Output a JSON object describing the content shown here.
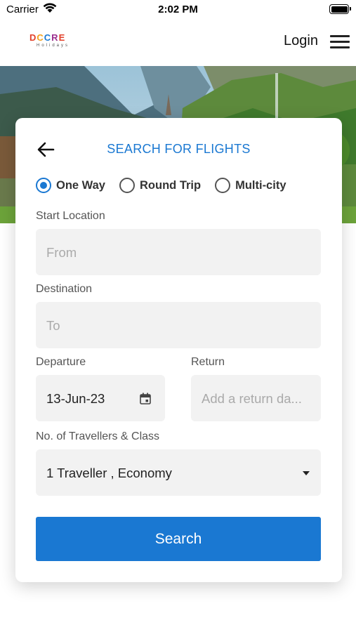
{
  "status_bar": {
    "carrier": "Carrier",
    "time": "2:02 PM",
    "battery_level": 1.0
  },
  "navbar": {
    "logo_letters": [
      "D",
      "C",
      "C",
      "R",
      "E"
    ],
    "logo_colors": [
      "#e2412b",
      "#f4a21c",
      "#1a78d2",
      "#9b2f8f",
      "#e2412b"
    ],
    "logo_subtitle": "Holidays",
    "login_label": "Login",
    "menu_icon": "hamburger-icon"
  },
  "search": {
    "back_icon": "arrow-left-icon",
    "title": "SEARCH FOR FLIGHTS",
    "trip_types": [
      {
        "label": "One Way",
        "selected": true
      },
      {
        "label": "Round Trip",
        "selected": false
      },
      {
        "label": "Multi-city",
        "selected": false
      }
    ],
    "start_location": {
      "label": "Start Location",
      "placeholder": "From",
      "value": ""
    },
    "destination": {
      "label": "Destination",
      "placeholder": "To",
      "value": ""
    },
    "departure": {
      "label": "Departure",
      "value": "13-Jun-23",
      "icon": "calendar-icon"
    },
    "return": {
      "label": "Return",
      "placeholder": "Add a return da..."
    },
    "travellers": {
      "label": "No. of Travellers & Class",
      "value": "1 Traveller , Economy",
      "icon": "caret-down-icon"
    },
    "submit_label": "Search"
  },
  "colors": {
    "accent": "#1a78d2",
    "field_bg": "#f2f2f2"
  }
}
